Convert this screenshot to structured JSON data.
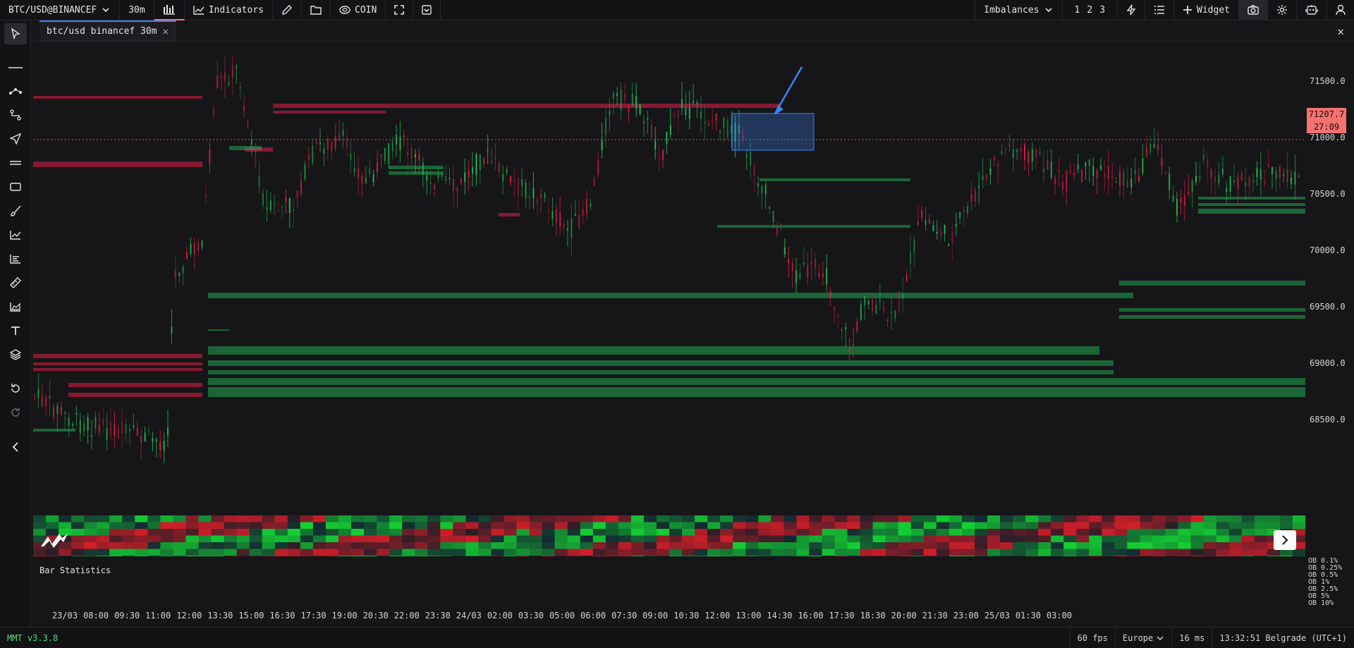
{
  "toolbar": {
    "symbol": "BTC/USD@BINANCEF",
    "timeframe": "30m",
    "indicators_label": "Indicators",
    "coin_label": "COIN",
    "imbalances_label": "Imbalances",
    "presets": [
      "1",
      "2",
      "3"
    ],
    "widget_label": "Widget"
  },
  "tab": {
    "label": "btc/usd binancef 30m"
  },
  "sidebar_tools": [
    "cursor-icon",
    "horizontal-line-icon",
    "nodes-icon",
    "path-icon",
    "send-icon",
    "parallel-lines-icon",
    "rectangle-icon",
    "brush-icon",
    "line-chart-icon",
    "bars-icon",
    "ruler-icon",
    "area-chart-icon",
    "text-icon",
    "layers-icon",
    "undo-icon",
    "redo-icon",
    "collapse-icon"
  ],
  "price_axis": {
    "labels": [
      "71500.0",
      "71000.0",
      "70500.0",
      "70000.0",
      "69500.0",
      "69000.0",
      "68500.0"
    ],
    "current_price": "71207.7",
    "countdown": "27:09"
  },
  "time_axis": {
    "labels": [
      "23/03",
      "08:00",
      "09:30",
      "11:00",
      "12:00",
      "13:30",
      "15:00",
      "16:30",
      "17:30",
      "19:00",
      "20:30",
      "22:00",
      "23:30",
      "24/03",
      "02:00",
      "03:30",
      "05:00",
      "06:00",
      "07:30",
      "09:00",
      "10:30",
      "12:00",
      "13:00",
      "14:30",
      "16:00",
      "17:30",
      "18:30",
      "20:00",
      "21:30",
      "23:00",
      "25/03",
      "01:30",
      "03:00"
    ]
  },
  "bar_statistics": {
    "title": "Bar Statistics",
    "rows": [
      "OB 0.1%",
      "OB 0.25%",
      "OB 0.5%",
      "OB 1%",
      "OB 2.5%",
      "OB 5%",
      "OB 10%"
    ]
  },
  "status_bar": {
    "version": "MMT v3.3.8",
    "fps": "60 fps",
    "region": "Europe",
    "latency": "16 ms",
    "clock": "13:32:51 Belgrade (UTC+1)"
  },
  "colors": {
    "bull": "#22c55e",
    "bear": "#e11d48",
    "current_price": "#f87171",
    "highlight": "#3b82f6",
    "background": "#161618"
  }
}
